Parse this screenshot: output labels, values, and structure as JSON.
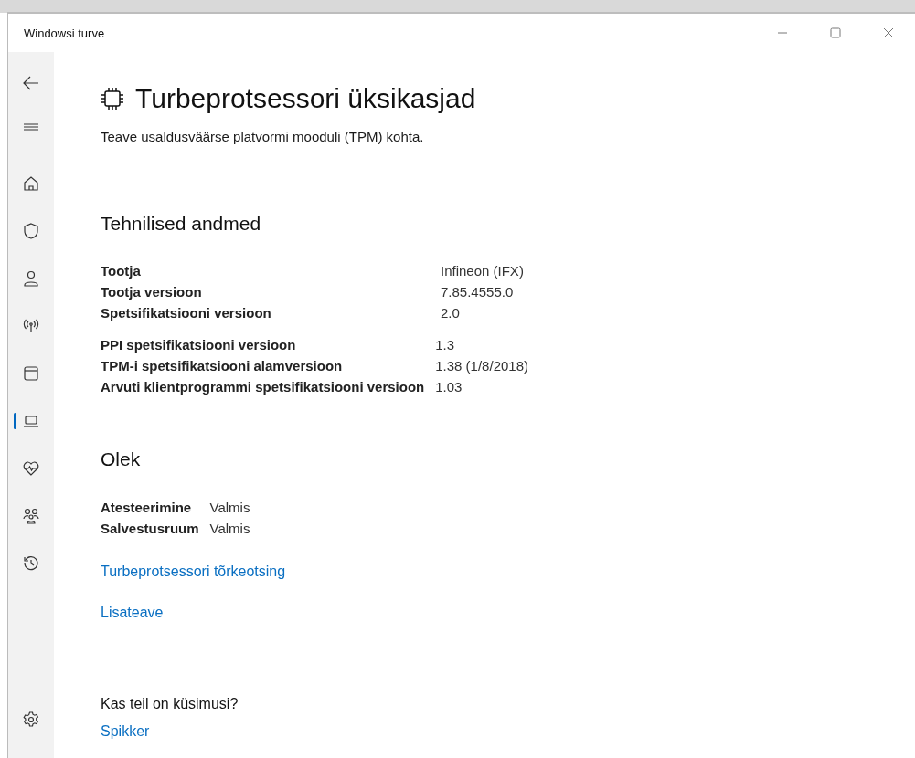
{
  "window": {
    "title": "Windowsi turve"
  },
  "nav": [
    {
      "kind": "back",
      "selected": false
    },
    {
      "kind": "menu",
      "selected": false
    },
    {
      "kind": "home",
      "selected": false
    },
    {
      "kind": "shield",
      "selected": false
    },
    {
      "kind": "person",
      "selected": false
    },
    {
      "kind": "signal",
      "selected": false
    },
    {
      "kind": "app",
      "selected": false
    },
    {
      "kind": "laptop",
      "selected": true
    },
    {
      "kind": "heart",
      "selected": false
    },
    {
      "kind": "family",
      "selected": false
    },
    {
      "kind": "history",
      "selected": false
    }
  ],
  "page": {
    "title": "Turbeprotsessori üksikasjad",
    "subtitle": "Teave usaldusväärse platvormi mooduli (TPM) kohta."
  },
  "specs": {
    "heading": "Tehnilised andmed",
    "groups": [
      {
        "rows": [
          {
            "label": "Tootja",
            "value": "Infineon (IFX)"
          },
          {
            "label": "Tootja versioon",
            "value": "7.85.4555.0"
          },
          {
            "label": "Spetsifikatsiooni versioon",
            "value": "2.0"
          }
        ]
      },
      {
        "rows": [
          {
            "label": "PPI spetsifikatsiooni versioon",
            "value": "1.3"
          },
          {
            "label": "TPM-i spetsifikatsiooni alamversioon",
            "value": "1.38 (1/8/2018)"
          },
          {
            "label": "Arvuti klientprogrammi spetsifikatsiooni versioon",
            "value": "1.03"
          }
        ]
      }
    ]
  },
  "status": {
    "heading": "Olek",
    "rows": [
      {
        "label": "Atesteerimine",
        "value": "Valmis"
      },
      {
        "label": "Salvestusruum",
        "value": "Valmis"
      }
    ]
  },
  "links": [
    "Turbeprotsessori tõrkeotsing",
    "Lisateave"
  ],
  "help": {
    "heading": "Kas teil on küsimusi?",
    "link": "Spikker"
  }
}
